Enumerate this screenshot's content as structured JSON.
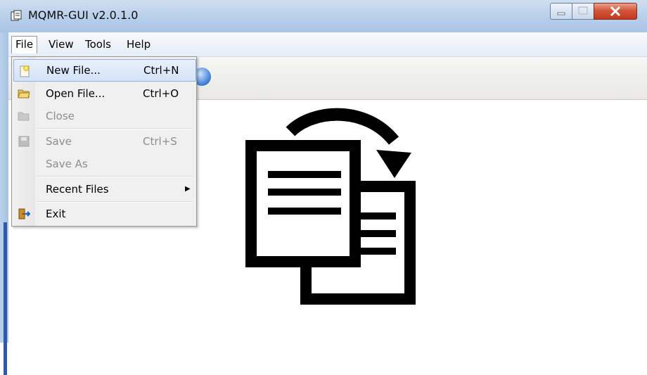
{
  "window": {
    "title": "MQMR-GUI v2.0.1.0",
    "controls": [
      "minimize-icon",
      "maximize-icon",
      "close-icon"
    ]
  },
  "menubar": {
    "items": [
      {
        "label": "File",
        "active": true
      },
      {
        "label": "View"
      },
      {
        "label": "Tools"
      },
      {
        "label": "Help"
      }
    ]
  },
  "file_menu": {
    "items": [
      {
        "label": "New File...",
        "shortcut": "Ctrl+N",
        "icon": "new-file-icon",
        "highlighted": true
      },
      {
        "label": "Open File...",
        "shortcut": "Ctrl+O",
        "icon": "open-folder-icon"
      },
      {
        "label": "Close",
        "icon": "folder-icon",
        "disabled": true
      },
      {
        "label": "Save",
        "shortcut": "Ctrl+S",
        "icon": "save-icon",
        "disabled": true
      },
      {
        "label": "Save As"
      },
      {
        "label": "Recent Files",
        "submenu": true
      },
      {
        "label": "Exit",
        "icon": "exit-icon"
      }
    ]
  },
  "main": {
    "logo": "document-swap-icon"
  },
  "colors": {
    "menu_highlight": "#d4e3f8",
    "menu_highlight_border": "#8fb0e3",
    "close_button": "#c0391f",
    "disabled_text": "#8d8d8d"
  }
}
